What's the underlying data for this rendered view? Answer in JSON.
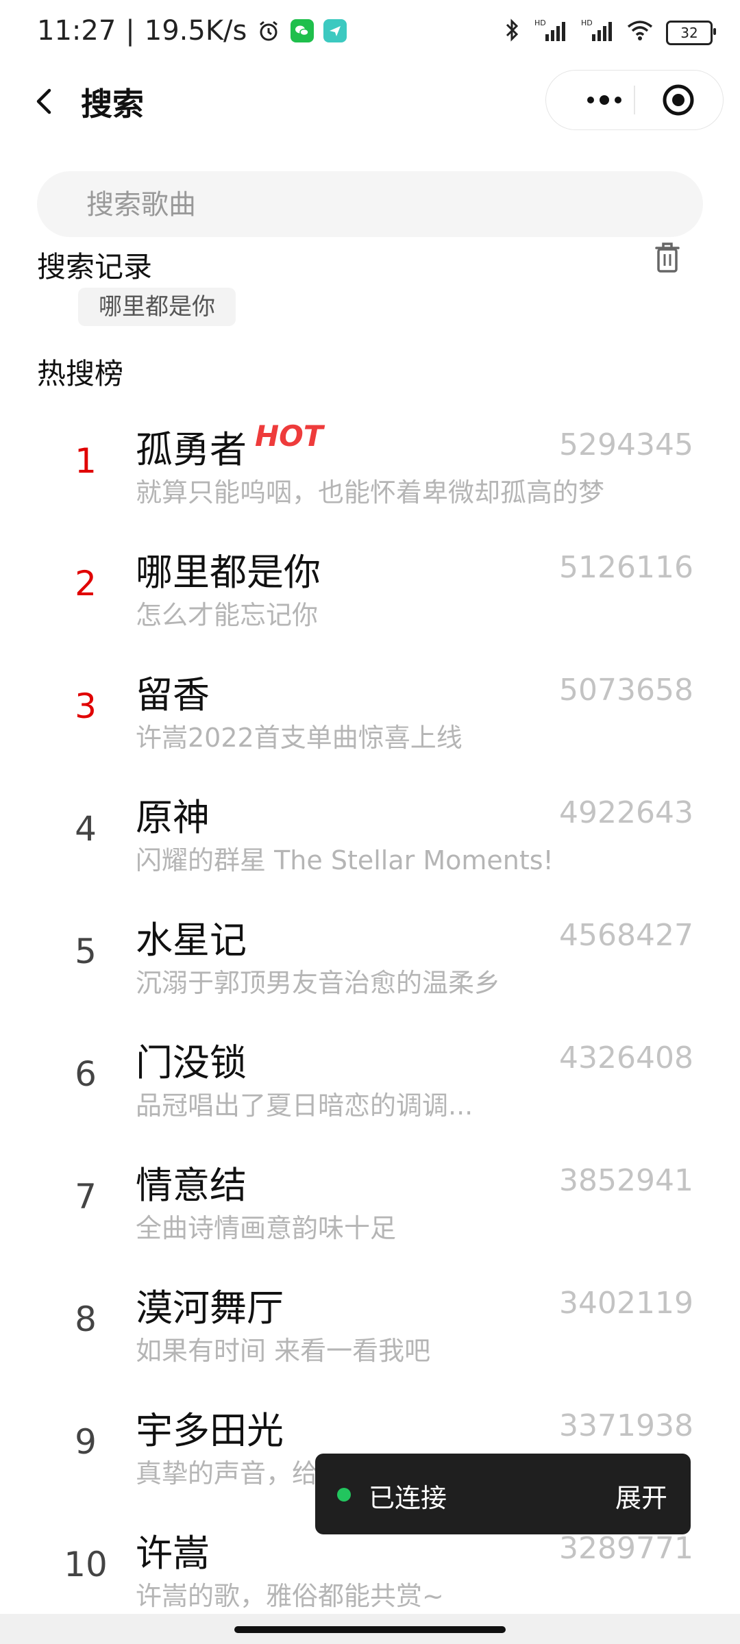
{
  "status_bar": {
    "time": "11:27",
    "separator": "|",
    "speed": "19.5K/s",
    "battery": "32",
    "signal1": "HD",
    "signal2": "HD"
  },
  "header": {
    "title": "搜索"
  },
  "search": {
    "placeholder": "搜索歌曲",
    "value": ""
  },
  "history": {
    "title": "搜索记录",
    "items": [
      "哪里都是你"
    ]
  },
  "hot": {
    "title": "热搜榜",
    "hot_badge": "HOT",
    "items": [
      {
        "rank": "1",
        "title": "孤勇者",
        "desc": "就算只能呜咽，也能怀着卑微却孤高的梦",
        "count": "5294345"
      },
      {
        "rank": "2",
        "title": "哪里都是你",
        "desc": "怎么才能忘记你",
        "count": "5126116"
      },
      {
        "rank": "3",
        "title": "留香",
        "desc": "许嵩2022首支单曲惊喜上线",
        "count": "5073658"
      },
      {
        "rank": "4",
        "title": "原神",
        "desc": "闪耀的群星 The Stellar Moments!",
        "count": "4922643"
      },
      {
        "rank": "5",
        "title": "水星记",
        "desc": "沉溺于郭顶男友音治愈的温柔乡",
        "count": "4568427"
      },
      {
        "rank": "6",
        "title": "门没锁",
        "desc": "品冠唱出了夏日暗恋的调调...",
        "count": "4326408"
      },
      {
        "rank": "7",
        "title": "情意结",
        "desc": "全曲诗情画意韵味十足",
        "count": "3852941"
      },
      {
        "rank": "8",
        "title": "漠河舞厅",
        "desc": "如果有时间 来看一看我吧",
        "count": "3402119"
      },
      {
        "rank": "9",
        "title": "宇多田光",
        "desc": "真挚的声音，给人温暖",
        "count": "3371938"
      },
      {
        "rank": "10",
        "title": "许嵩",
        "desc": "许嵩的歌，雅俗都能共赏~",
        "count": "3289771"
      }
    ]
  },
  "toast": {
    "status": "已连接",
    "action": "展开",
    "dot_color": "#22c55e"
  },
  "colors": {
    "rank_top": "#e00000",
    "hot_badge": "#ee3b3b",
    "muted": "#b5b5b5"
  }
}
